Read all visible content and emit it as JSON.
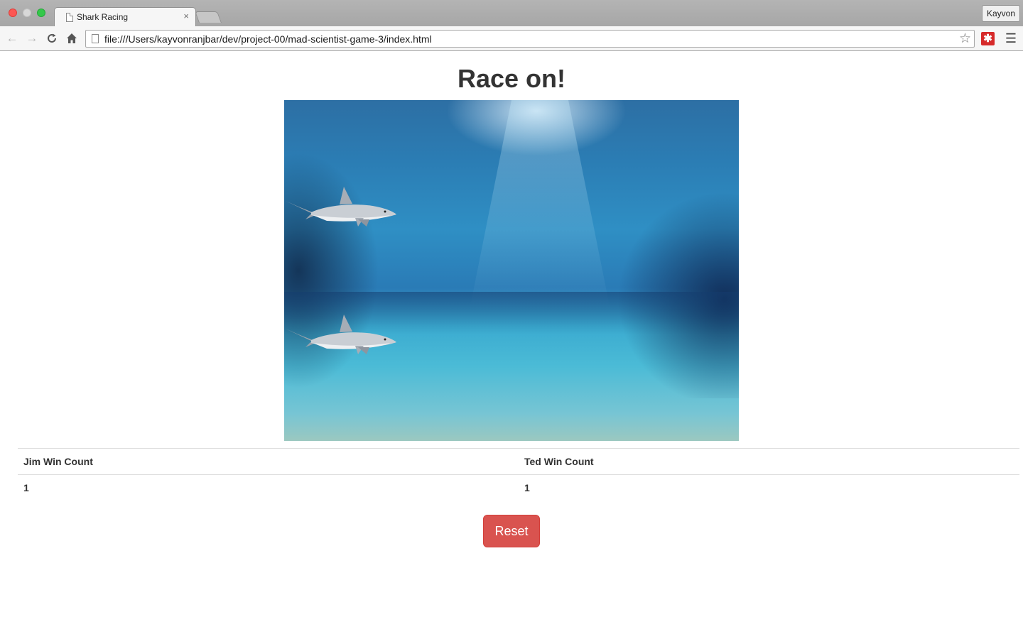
{
  "browser": {
    "tab_title": "Shark Racing",
    "tab_close": "×",
    "profile_name": "Kayvon",
    "url": "file:///Users/kayvonranjbar/dev/project-00/mad-scientist-game-3/index.html",
    "icons": {
      "back": "back-arrow-icon",
      "forward": "forward-arrow-icon",
      "reload": "reload-icon",
      "home": "home-icon",
      "bookmark": "star-icon",
      "extension": "asterisk-extension-icon",
      "menu": "hamburger-menu-icon"
    },
    "extension_color": "#d62a2a"
  },
  "page": {
    "title": "Race on!",
    "racers": [
      {
        "name": "jim-shark"
      },
      {
        "name": "ted-shark"
      }
    ],
    "table": {
      "headers": [
        "Jim Win Count",
        "Ted Win Count"
      ],
      "rows": [
        [
          "1",
          "1"
        ]
      ]
    },
    "reset_label": "Reset",
    "reset_color": "#d9534f"
  }
}
